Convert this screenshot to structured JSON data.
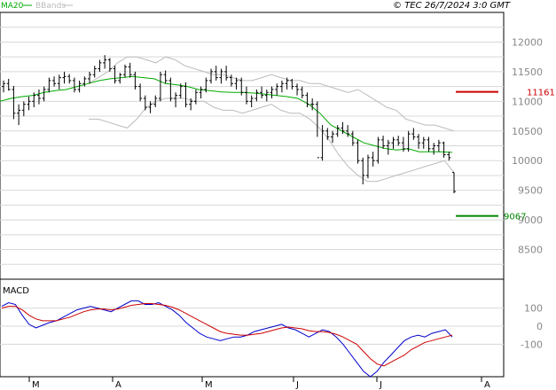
{
  "header": {
    "title": "© TEC 26/7/2024 3:0 GMT",
    "legend": [
      {
        "name": "MA20",
        "color": "#00aa00"
      },
      {
        "name": "BBands",
        "color": "#bbbbbb"
      }
    ]
  },
  "chart_data": [
    {
      "type": "line",
      "panel": "price",
      "ylim": [
        8000,
        12500
      ],
      "y_ticks": [
        "12000",
        "11500",
        "11000",
        "10500",
        "10000",
        "9500",
        "9000",
        "8500"
      ],
      "x_labels": [
        "M",
        "A",
        "M",
        "J",
        "J",
        "A"
      ],
      "grid": true,
      "series": [
        {
          "name": "MA20",
          "color": "#00aa00"
        },
        {
          "name": "BBands",
          "color": "#bbbbbb"
        }
      ],
      "ohlc": [
        [
          11250,
          11350,
          11150,
          11300
        ],
        [
          11300,
          11380,
          11180,
          11200
        ],
        [
          11200,
          11260,
          10700,
          10800
        ],
        [
          10800,
          10950,
          10600,
          10850
        ],
        [
          10850,
          11000,
          10750,
          10950
        ],
        [
          10950,
          11080,
          10850,
          11000
        ],
        [
          11000,
          11150,
          10900,
          11100
        ],
        [
          11100,
          11200,
          10950,
          11050
        ],
        [
          11050,
          11250,
          11000,
          11200
        ],
        [
          11200,
          11400,
          11150,
          11350
        ],
        [
          11350,
          11420,
          11250,
          11300
        ],
        [
          11300,
          11450,
          11200,
          11400
        ],
        [
          11400,
          11500,
          11300,
          11420
        ],
        [
          11420,
          11460,
          11300,
          11350
        ],
        [
          11350,
          11400,
          11150,
          11200
        ],
        [
          11200,
          11350,
          11150,
          11300
        ],
        [
          11300,
          11420,
          11250,
          11380
        ],
        [
          11380,
          11500,
          11300,
          11450
        ],
        [
          11450,
          11600,
          11400,
          11550
        ],
        [
          11550,
          11700,
          11500,
          11650
        ],
        [
          11650,
          11780,
          11550,
          11700
        ],
        [
          11700,
          11730,
          11500,
          11550
        ],
        [
          11550,
          11600,
          11300,
          11350
        ],
        [
          11350,
          11480,
          11300,
          11450
        ],
        [
          11450,
          11620,
          11400,
          11580
        ],
        [
          11580,
          11650,
          11400,
          11450
        ],
        [
          11450,
          11500,
          11200,
          11250
        ],
        [
          11250,
          11300,
          11000,
          11050
        ],
        [
          11050,
          11100,
          10850,
          10900
        ],
        [
          10900,
          11000,
          10800,
          10950
        ],
        [
          10950,
          11100,
          10900,
          11050
        ],
        [
          11050,
          11500,
          11000,
          11450
        ],
        [
          11450,
          11520,
          11300,
          11350
        ],
        [
          11350,
          11400,
          11000,
          11050
        ],
        [
          11050,
          11150,
          10900,
          11100
        ],
        [
          11100,
          11300,
          11050,
          11250
        ],
        [
          11250,
          11320,
          10900,
          10950
        ],
        [
          10950,
          11050,
          10850,
          11000
        ],
        [
          11000,
          11200,
          10950,
          11150
        ],
        [
          11150,
          11250,
          11050,
          11200
        ],
        [
          11200,
          11400,
          11150,
          11350
        ],
        [
          11350,
          11550,
          11300,
          11500
        ],
        [
          11500,
          11600,
          11350,
          11400
        ],
        [
          11400,
          11550,
          11300,
          11500
        ],
        [
          11500,
          11600,
          11350,
          11400
        ],
        [
          11400,
          11450,
          11250,
          11300
        ],
        [
          11300,
          11400,
          11200,
          11350
        ],
        [
          11350,
          11400,
          11100,
          11150
        ],
        [
          11150,
          11250,
          10950,
          11000
        ],
        [
          11000,
          11100,
          10900,
          11050
        ],
        [
          11050,
          11200,
          11000,
          11150
        ],
        [
          11150,
          11250,
          11050,
          11100
        ],
        [
          11100,
          11200,
          11000,
          11150
        ],
        [
          11150,
          11250,
          11050,
          11200
        ],
        [
          11200,
          11300,
          11100,
          11250
        ],
        [
          11250,
          11350,
          11150,
          11300
        ],
        [
          11300,
          11400,
          11200,
          11350
        ],
        [
          11350,
          11380,
          11200,
          11250
        ],
        [
          11250,
          11300,
          11100,
          11200
        ],
        [
          11200,
          11250,
          11050,
          11100
        ],
        [
          11100,
          11150,
          10900,
          10950
        ],
        [
          10950,
          11050,
          10850,
          10950
        ],
        [
          10950,
          11000,
          10400,
          10050
        ],
        [
          10050,
          10600,
          10000,
          10500
        ],
        [
          10500,
          10550,
          10350,
          10400
        ],
        [
          10400,
          10500,
          10300,
          10450
        ],
        [
          10450,
          10600,
          10400,
          10550
        ],
        [
          10550,
          10650,
          10450,
          10500
        ],
        [
          10500,
          10600,
          10400,
          10450
        ],
        [
          10450,
          10500,
          10250,
          10300
        ],
        [
          10300,
          10350,
          9950,
          10000
        ],
        [
          10000,
          10050,
          9600,
          9750
        ],
        [
          9750,
          10100,
          9700,
          10050
        ],
        [
          10050,
          10150,
          9900,
          10000
        ],
        [
          10000,
          10400,
          9950,
          10350
        ],
        [
          10350,
          10420,
          10200,
          10250
        ],
        [
          10250,
          10350,
          10100,
          10300
        ],
        [
          10300,
          10400,
          10200,
          10350
        ],
        [
          10350,
          10420,
          10250,
          10300
        ],
        [
          10300,
          10400,
          10150,
          10200
        ],
        [
          10200,
          10500,
          10150,
          10450
        ],
        [
          10450,
          10550,
          10350,
          10400
        ],
        [
          10400,
          10450,
          10200,
          10300
        ],
        [
          10300,
          10400,
          10200,
          10350
        ],
        [
          10350,
          10400,
          10150,
          10200
        ],
        [
          10200,
          10300,
          10100,
          10250
        ],
        [
          10250,
          10350,
          10150,
          10300
        ],
        [
          10300,
          10320,
          10050,
          10100
        ],
        [
          10100,
          10150,
          10000,
          10050
        ],
        [
          9800,
          9800,
          9450,
          9480
        ]
      ],
      "ma20": [
        11000,
        11050,
        11080,
        11100,
        11150,
        11180,
        11200,
        11250,
        11300,
        11350,
        11380,
        11400,
        11420,
        11400,
        11380,
        11300,
        11280,
        11250,
        11200,
        11180,
        11160,
        11150,
        11150,
        11140,
        11120,
        11100,
        11080,
        11050,
        10950,
        10800,
        10600,
        10500,
        10400,
        10300,
        10250,
        10200,
        10180,
        10200,
        10150,
        10150,
        10150,
        10140
      ],
      "bb_upper": [
        11300,
        11400,
        11500,
        11650,
        11750,
        11750,
        11700,
        11650,
        11750,
        11700,
        11600,
        11550,
        11500,
        11450,
        11450,
        11400,
        11350,
        11350,
        11400,
        11450,
        11400,
        11350,
        11350,
        11300,
        11300,
        11250,
        11200,
        11150,
        11200,
        11100,
        11000,
        10900,
        10850,
        10700,
        10650,
        10600,
        10600,
        10550,
        10500
      ],
      "bb_lower": [
        10700,
        10700,
        10650,
        10600,
        10550,
        10700,
        10900,
        11000,
        11050,
        11050,
        11050,
        11000,
        11000,
        10900,
        10850,
        10850,
        10800,
        10850,
        10900,
        10950,
        10850,
        10800,
        10800,
        10700,
        10550,
        10350,
        10100,
        9900,
        9750,
        9650,
        9650,
        9700,
        9750,
        9800,
        9850,
        9900,
        9950,
        10000,
        9800
      ],
      "levels": [
        {
          "value": "11161",
          "color": "#cc0000"
        },
        {
          "value": "9067",
          "color": "#008800"
        }
      ]
    },
    {
      "type": "line",
      "panel": "macd",
      "title": "MACD",
      "ylim": [
        -280,
        260
      ],
      "y_ticks": [
        "100",
        "0",
        "-100"
      ],
      "series": [
        {
          "name": "",
          "color": "#0000cc",
          "values": [
            110,
            130,
            120,
            60,
            10,
            -10,
            5,
            20,
            30,
            50,
            70,
            90,
            100,
            110,
            100,
            90,
            80,
            100,
            120,
            140,
            140,
            120,
            120,
            130,
            110,
            90,
            60,
            20,
            -10,
            -40,
            -60,
            -70,
            -80,
            -70,
            -60,
            -60,
            -50,
            -30,
            -20,
            -10,
            0,
            10,
            -10,
            -20,
            -40,
            -60,
            -40,
            -20,
            -30,
            -60,
            -100,
            -150,
            -200,
            -250,
            -280,
            -250,
            -200,
            -160,
            -120,
            -80,
            -60,
            -50,
            -60,
            -40,
            -30,
            -20,
            -60
          ]
        },
        {
          "name": "",
          "color": "#cc0000",
          "values": [
            100,
            110,
            110,
            90,
            60,
            40,
            30,
            30,
            30,
            40,
            50,
            65,
            80,
            90,
            95,
            95,
            90,
            95,
            105,
            115,
            120,
            125,
            125,
            120,
            115,
            105,
            90,
            70,
            50,
            30,
            10,
            -10,
            -30,
            -40,
            -45,
            -50,
            -50,
            -45,
            -40,
            -30,
            -20,
            -10,
            -5,
            -10,
            -15,
            -25,
            -30,
            -30,
            -35,
            -45,
            -60,
            -80,
            -100,
            -140,
            -180,
            -210,
            -220,
            -200,
            -180,
            -160,
            -130,
            -110,
            -90,
            -80,
            -70,
            -60,
            -50
          ]
        }
      ]
    }
  ]
}
